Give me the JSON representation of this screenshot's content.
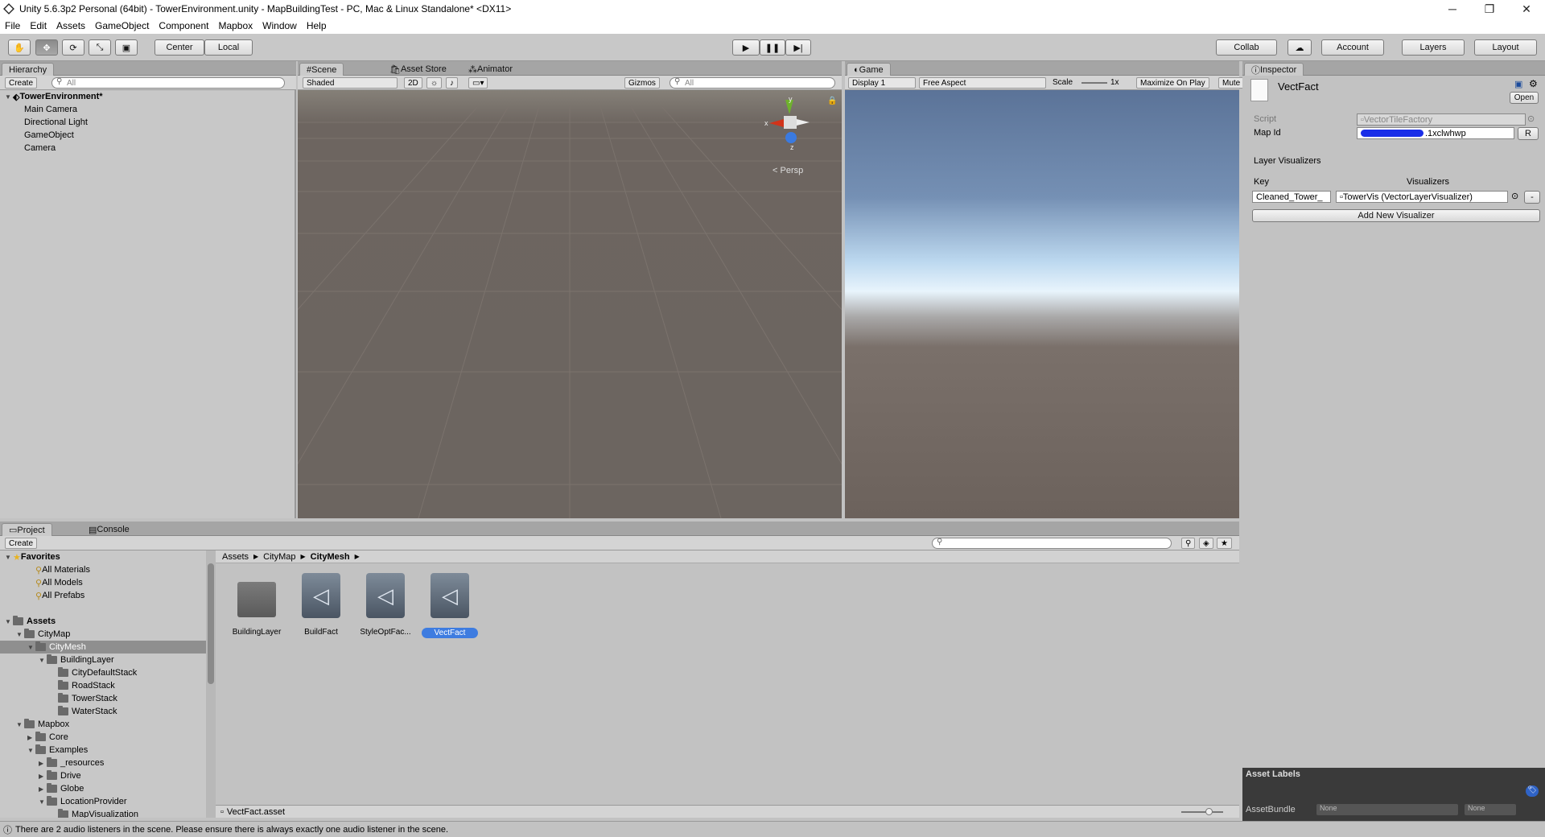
{
  "window": {
    "title": "Unity 5.6.3p2 Personal (64bit) - TowerEnvironment.unity - MapBuildingTest - PC, Mac & Linux Standalone* <DX11>",
    "min": "─",
    "max": "❐",
    "close": "✕"
  },
  "menu": [
    "File",
    "Edit",
    "Assets",
    "GameObject",
    "Component",
    "Mapbox",
    "Window",
    "Help"
  ],
  "toolbar": {
    "center": "Center",
    "local": "Local",
    "collab": "Collab",
    "account": "Account",
    "layers": "Layers",
    "layout": "Layout"
  },
  "hierarchy": {
    "tab": "Hierarchy",
    "create": "Create",
    "search": "All",
    "scene": "TowerEnvironment*",
    "items": [
      "Main Camera",
      "Directional Light",
      "GameObject",
      "Camera"
    ]
  },
  "scene": {
    "tabs": [
      "Scene",
      "Asset Store",
      "Animator"
    ],
    "shaded": "Shaded",
    "mode2d": "2D",
    "gizmos": "Gizmos",
    "search": "All",
    "persp": "Persp",
    "axis_y": "y",
    "axis_x": "x",
    "axis_z": "z"
  },
  "game": {
    "tab": "Game",
    "display": "Display 1",
    "aspect": "Free Aspect",
    "scale": "Scale",
    "scale_val": "1x",
    "maximize": "Maximize On Play",
    "mute": "Mute"
  },
  "inspector": {
    "tab": "Inspector",
    "name": "VectFact",
    "open": "Open",
    "script_label": "Script",
    "script_value": "VectorTileFactory",
    "mapid_label": "Map Id",
    "mapid_value": ".1xclwhwp",
    "r_btn": "R",
    "layer_vis": "Layer Visualizers",
    "key_header": "Key",
    "vis_header": "Visualizers",
    "key_value": "Cleaned_Tower_",
    "vis_value": "TowerVis (VectorLayerVisualizer)",
    "minus": "-",
    "add_btn": "Add New Visualizer",
    "asset_labels": "Asset Labels",
    "asset_bundle": "AssetBundle",
    "none1": "None",
    "none2": "None"
  },
  "project": {
    "tabs": [
      "Project",
      "Console"
    ],
    "create": "Create",
    "tree": [
      {
        "label": "Favorites",
        "indent": 0,
        "bold": true,
        "icon": "star",
        "arrow": "▼"
      },
      {
        "label": "All Materials",
        "indent": 2,
        "icon": "search"
      },
      {
        "label": "All Models",
        "indent": 2,
        "icon": "search"
      },
      {
        "label": "All Prefabs",
        "indent": 2,
        "icon": "search"
      },
      {
        "label": "",
        "indent": 0
      },
      {
        "label": "Assets",
        "indent": 0,
        "bold": true,
        "icon": "folder",
        "arrow": "▼"
      },
      {
        "label": "CityMap",
        "indent": 1,
        "icon": "folder",
        "arrow": "▼"
      },
      {
        "label": "CityMesh",
        "indent": 2,
        "icon": "folder",
        "arrow": "▼",
        "selected": true
      },
      {
        "label": "BuildingLayer",
        "indent": 3,
        "icon": "folder",
        "arrow": "▼"
      },
      {
        "label": "CityDefaultStack",
        "indent": 4,
        "icon": "folder"
      },
      {
        "label": "RoadStack",
        "indent": 4,
        "icon": "folder"
      },
      {
        "label": "TowerStack",
        "indent": 4,
        "icon": "folder"
      },
      {
        "label": "WaterStack",
        "indent": 4,
        "icon": "folder"
      },
      {
        "label": "Mapbox",
        "indent": 1,
        "icon": "folder",
        "arrow": "▼"
      },
      {
        "label": "Core",
        "indent": 2,
        "icon": "folder",
        "arrow": "▶"
      },
      {
        "label": "Examples",
        "indent": 2,
        "icon": "folder",
        "arrow": "▼"
      },
      {
        "label": "_resources",
        "indent": 3,
        "icon": "folder",
        "arrow": "▶"
      },
      {
        "label": "Drive",
        "indent": 3,
        "icon": "folder",
        "arrow": "▶"
      },
      {
        "label": "Globe",
        "indent": 3,
        "icon": "folder",
        "arrow": "▶"
      },
      {
        "label": "LocationProvider",
        "indent": 3,
        "icon": "folder",
        "arrow": "▼"
      },
      {
        "label": "MapVisualization",
        "indent": 4,
        "icon": "folder"
      }
    ],
    "breadcrumb": [
      "Assets",
      "CityMap",
      "CityMesh"
    ],
    "assets": [
      {
        "label": "BuildingLayer",
        "kind": "folder"
      },
      {
        "label": "BuildFact",
        "kind": "unity"
      },
      {
        "label": "StyleOptFac...",
        "kind": "unity"
      },
      {
        "label": "VectFact",
        "kind": "unity",
        "selected": true
      }
    ],
    "footer": "VectFact.asset"
  },
  "status": "There are 2 audio listeners in the scene. Please ensure there is always exactly one audio listener in the scene.",
  "colors": {
    "scene_bg": "#6d6560",
    "game_sky_top": "#5b7398",
    "game_ground": "#6c625c",
    "select_blue": "#3e7ce0"
  }
}
